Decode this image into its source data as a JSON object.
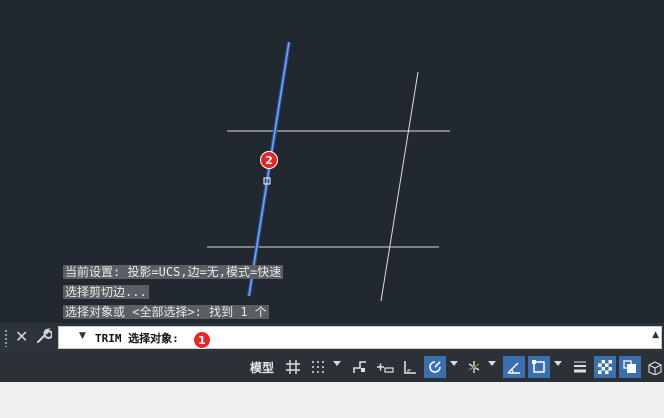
{
  "history": [
    "当前设置: 投影=UCS,边=无,模式=快速",
    "选择剪切边...",
    "选择对象或 <全部选择>:  找到 1 个"
  ],
  "command": {
    "prompt": "TRIM 选择对象:"
  },
  "badges": {
    "first": "1",
    "second": "2"
  },
  "status": {
    "model_label": "模型"
  },
  "colors": {
    "canvas": "#212830",
    "selected_line": "#6ea6ff",
    "geometry": "#dcdcdc",
    "badge": "#e8262a",
    "toggle_on": "#3c6fae"
  }
}
